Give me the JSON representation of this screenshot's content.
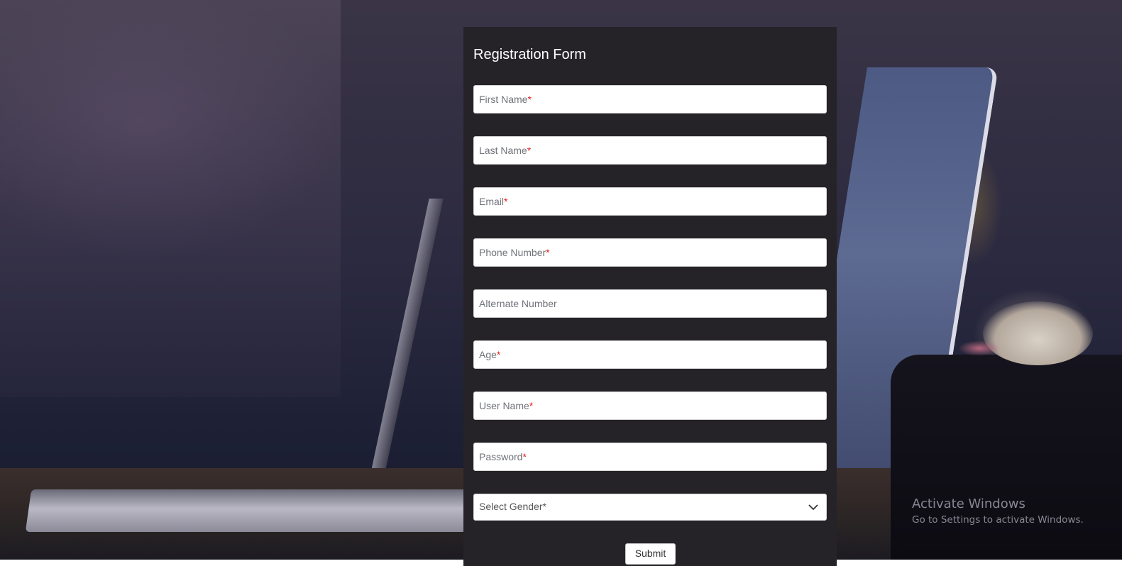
{
  "form": {
    "title": "Registration Form",
    "fields": [
      {
        "label": "First Name",
        "required": true
      },
      {
        "label": "Last Name",
        "required": true
      },
      {
        "label": "Email",
        "required": true
      },
      {
        "label": "Phone Number",
        "required": true
      },
      {
        "label": "Alternate Number",
        "required": false
      },
      {
        "label": "Age",
        "required": true
      },
      {
        "label": "User Name",
        "required": true
      },
      {
        "label": "Password",
        "required": true
      }
    ],
    "required_mark": "*",
    "gender_select": {
      "placeholder": "Select Gender*",
      "icon": "chevron-down-icon"
    },
    "submit_label": "Submit"
  },
  "watermark": {
    "line1": "Activate Windows",
    "line2": "Go to Settings to activate Windows."
  },
  "colors": {
    "panel": "#252328",
    "required": "#e21d1d"
  }
}
